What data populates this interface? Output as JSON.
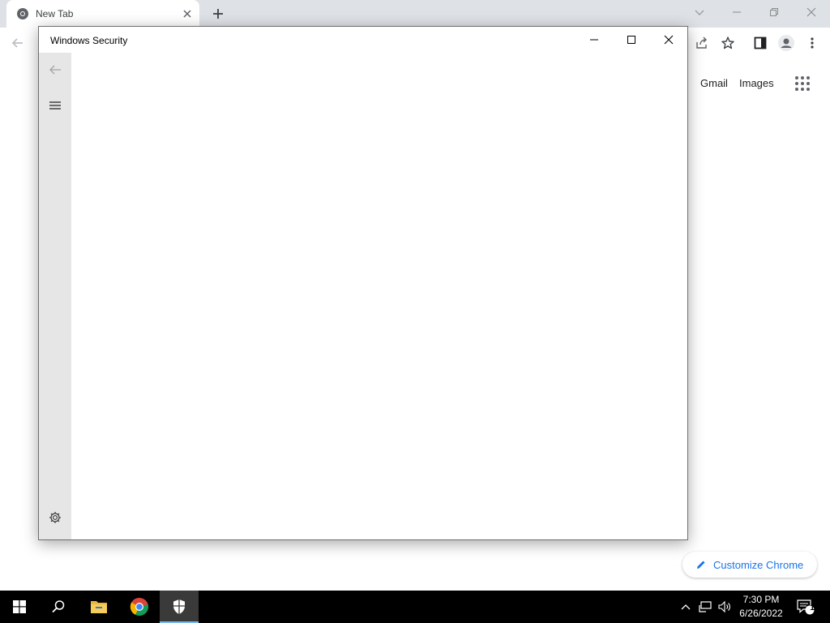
{
  "chrome": {
    "tab_title": "New Tab",
    "links": {
      "gmail": "Gmail",
      "images": "Images"
    },
    "customize_label": "Customize Chrome"
  },
  "security_window": {
    "title": "Windows Security"
  },
  "taskbar": {
    "time": "7:30 PM",
    "date": "6/26/2022",
    "notification_count": "1"
  },
  "colors": {
    "accent": "#1a73e8",
    "taskbar_active_indicator": "#76b9ed",
    "sidebar_bg": "#e6e6e6"
  },
  "icons": [
    "chrome-icon",
    "close-icon",
    "plus-icon",
    "chevron-down-icon",
    "minimize-icon",
    "restore-icon",
    "back-arrow-icon",
    "share-icon",
    "star-icon",
    "side-panel-icon",
    "profile-icon",
    "more-vert-icon",
    "apps-grid-icon",
    "pencil-icon",
    "maximize-icon",
    "hamburger-icon",
    "settings-gear-icon",
    "windows-start-icon",
    "search-icon",
    "file-explorer-icon",
    "windows-security-icon",
    "chevron-up-icon",
    "network-icon",
    "volume-icon",
    "notification-icon"
  ]
}
